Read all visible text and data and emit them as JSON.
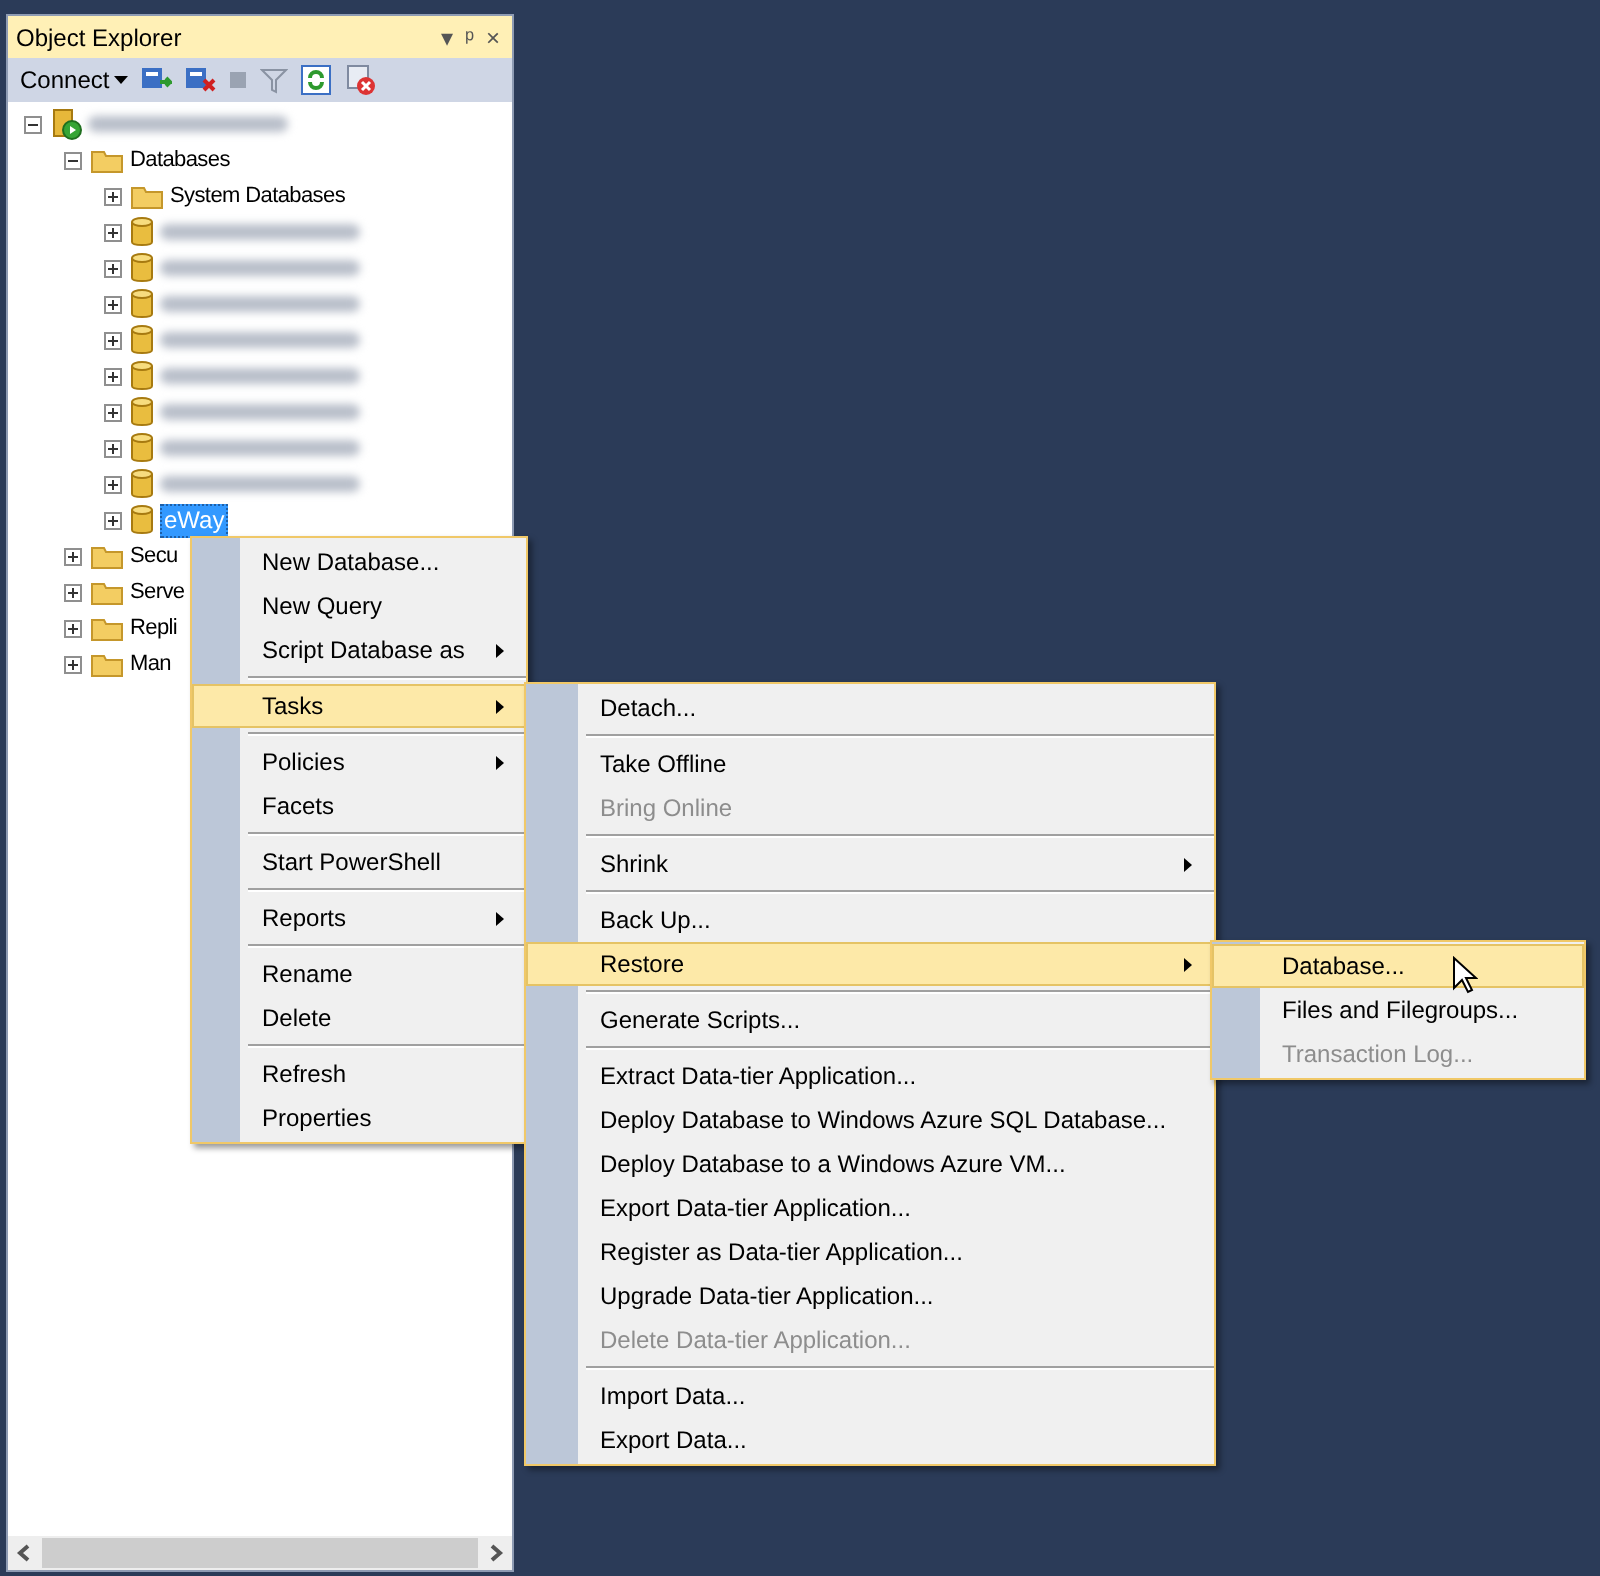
{
  "panel": {
    "title": "Object Explorer",
    "title_buttons": [
      "▾",
      "ᵖ",
      "×"
    ],
    "toolbar": {
      "connect": "Connect"
    }
  },
  "tree": [
    {
      "kind": "server",
      "expanded": true,
      "selected": false,
      "blurred": true,
      "children": [
        {
          "kind": "folder",
          "label": "Databases",
          "expanded": true,
          "selected": false,
          "children": [
            {
              "kind": "folder",
              "label": "System Databases",
              "expanded": false,
              "selected": false
            },
            {
              "kind": "database",
              "blurred": true,
              "expanded": false,
              "selected": false
            },
            {
              "kind": "database",
              "blurred": true,
              "expanded": false,
              "selected": false
            },
            {
              "kind": "database",
              "blurred": true,
              "expanded": false,
              "selected": false
            },
            {
              "kind": "database",
              "blurred": true,
              "expanded": false,
              "selected": false
            },
            {
              "kind": "database",
              "blurred": true,
              "expanded": false,
              "selected": false
            },
            {
              "kind": "database",
              "blurred": true,
              "expanded": false,
              "selected": false
            },
            {
              "kind": "database",
              "blurred": true,
              "expanded": false,
              "selected": false
            },
            {
              "kind": "database",
              "blurred": true,
              "expanded": false,
              "selected": false
            },
            {
              "kind": "database",
              "label": "eWay",
              "expanded": false,
              "selected": true
            }
          ]
        },
        {
          "kind": "folder",
          "label": "Secu",
          "expanded": false,
          "selected": false
        },
        {
          "kind": "folder",
          "label": "Serve",
          "expanded": false,
          "selected": false
        },
        {
          "kind": "folder",
          "label": "Repli",
          "expanded": false,
          "selected": false
        },
        {
          "kind": "folder",
          "label": "Man",
          "expanded": false,
          "selected": false
        }
      ]
    }
  ],
  "context_menu": [
    {
      "kind": "item",
      "label": "New Database...",
      "submenu": false,
      "selected": false,
      "disabled": false
    },
    {
      "kind": "item",
      "label": "New Query",
      "submenu": false,
      "selected": false,
      "disabled": false
    },
    {
      "kind": "item",
      "label": "Script Database as",
      "submenu": true,
      "selected": false,
      "disabled": false
    },
    {
      "kind": "separator"
    },
    {
      "kind": "item",
      "label": "Tasks",
      "submenu": true,
      "selected": true,
      "disabled": false
    },
    {
      "kind": "separator"
    },
    {
      "kind": "item",
      "label": "Policies",
      "submenu": true,
      "selected": false,
      "disabled": false
    },
    {
      "kind": "item",
      "label": "Facets",
      "submenu": false,
      "selected": false,
      "disabled": false
    },
    {
      "kind": "separator"
    },
    {
      "kind": "item",
      "label": "Start PowerShell",
      "submenu": false,
      "selected": false,
      "disabled": false
    },
    {
      "kind": "separator"
    },
    {
      "kind": "item",
      "label": "Reports",
      "submenu": true,
      "selected": false,
      "disabled": false
    },
    {
      "kind": "separator"
    },
    {
      "kind": "item",
      "label": "Rename",
      "submenu": false,
      "selected": false,
      "disabled": false
    },
    {
      "kind": "item",
      "label": "Delete",
      "submenu": false,
      "selected": false,
      "disabled": false
    },
    {
      "kind": "separator"
    },
    {
      "kind": "item",
      "label": "Refresh",
      "submenu": false,
      "selected": false,
      "disabled": false
    },
    {
      "kind": "item",
      "label": "Properties",
      "submenu": false,
      "selected": false,
      "disabled": false
    }
  ],
  "tasks_menu": [
    {
      "kind": "item",
      "label": "Detach...",
      "submenu": false,
      "selected": false,
      "disabled": false
    },
    {
      "kind": "separator"
    },
    {
      "kind": "item",
      "label": "Take Offline",
      "submenu": false,
      "selected": false,
      "disabled": false
    },
    {
      "kind": "item",
      "label": "Bring Online",
      "submenu": false,
      "selected": false,
      "disabled": true
    },
    {
      "kind": "separator"
    },
    {
      "kind": "item",
      "label": "Shrink",
      "submenu": true,
      "selected": false,
      "disabled": false
    },
    {
      "kind": "separator"
    },
    {
      "kind": "item",
      "label": "Back Up...",
      "submenu": false,
      "selected": false,
      "disabled": false
    },
    {
      "kind": "item",
      "label": "Restore",
      "submenu": true,
      "selected": true,
      "disabled": false
    },
    {
      "kind": "separator"
    },
    {
      "kind": "item",
      "label": "Generate Scripts...",
      "submenu": false,
      "selected": false,
      "disabled": false
    },
    {
      "kind": "separator"
    },
    {
      "kind": "item",
      "label": "Extract Data-tier Application...",
      "submenu": false,
      "selected": false,
      "disabled": false
    },
    {
      "kind": "item",
      "label": "Deploy Database to Windows Azure SQL Database...",
      "submenu": false,
      "selected": false,
      "disabled": false
    },
    {
      "kind": "item",
      "label": "Deploy Database to a Windows Azure VM...",
      "submenu": false,
      "selected": false,
      "disabled": false
    },
    {
      "kind": "item",
      "label": "Export Data-tier Application...",
      "submenu": false,
      "selected": false,
      "disabled": false
    },
    {
      "kind": "item",
      "label": "Register as Data-tier Application...",
      "submenu": false,
      "selected": false,
      "disabled": false
    },
    {
      "kind": "item",
      "label": "Upgrade Data-tier Application...",
      "submenu": false,
      "selected": false,
      "disabled": false
    },
    {
      "kind": "item",
      "label": "Delete Data-tier Application...",
      "submenu": false,
      "selected": false,
      "disabled": true
    },
    {
      "kind": "separator"
    },
    {
      "kind": "item",
      "label": "Import Data...",
      "submenu": false,
      "selected": false,
      "disabled": false
    },
    {
      "kind": "item",
      "label": "Export Data...",
      "submenu": false,
      "selected": false,
      "disabled": false
    }
  ],
  "restore_menu": [
    {
      "kind": "item",
      "label": "Database...",
      "submenu": false,
      "selected": true,
      "disabled": false
    },
    {
      "kind": "item",
      "label": "Files and Filegroups...",
      "submenu": false,
      "selected": false,
      "disabled": false
    },
    {
      "kind": "item",
      "label": "Transaction Log...",
      "submenu": false,
      "selected": false,
      "disabled": true
    }
  ]
}
